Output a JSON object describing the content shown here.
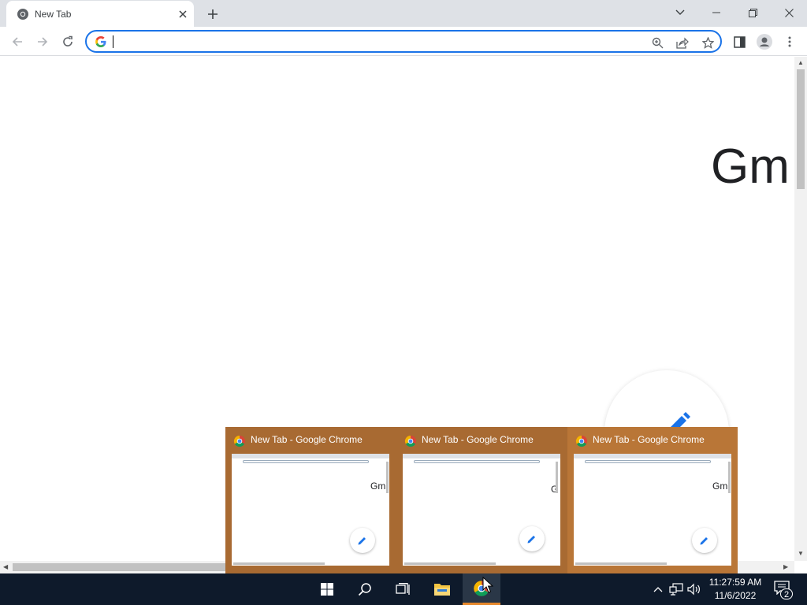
{
  "browser": {
    "tab": {
      "title": "New Tab"
    },
    "omnibox": {
      "value": "",
      "placeholder": ""
    }
  },
  "page": {
    "gmail_label": "Gm"
  },
  "taskbar_previews": [
    {
      "title": "New Tab - Google Chrome",
      "thumb_text": "Gm"
    },
    {
      "title": "New Tab - Google Chrome",
      "thumb_text": "G"
    },
    {
      "title": "New Tab - Google Chrome",
      "thumb_text": "Gm"
    }
  ],
  "taskbar": {
    "time": "11:27:59 AM",
    "date": "11/6/2022",
    "notification_count": "2"
  },
  "colors": {
    "accent": "#1a73e8",
    "preview_bg": "#a86a32",
    "taskbar_bg": "#0e1a2b",
    "active_indicator": "#e5872a"
  },
  "icons": [
    "chrome-icon",
    "close-icon",
    "plus-icon",
    "chevron-down-icon",
    "minimize-icon",
    "restore-icon",
    "back-arrow-icon",
    "forward-arrow-icon",
    "reload-icon",
    "google-g-icon",
    "zoom-icon",
    "share-icon",
    "star-icon",
    "side-panel-icon",
    "profile-icon",
    "kebab-menu-icon",
    "pencil-icon",
    "windows-start-icon",
    "search-icon",
    "task-view-icon",
    "file-explorer-icon",
    "network-icon",
    "speaker-icon",
    "notification-icon"
  ]
}
